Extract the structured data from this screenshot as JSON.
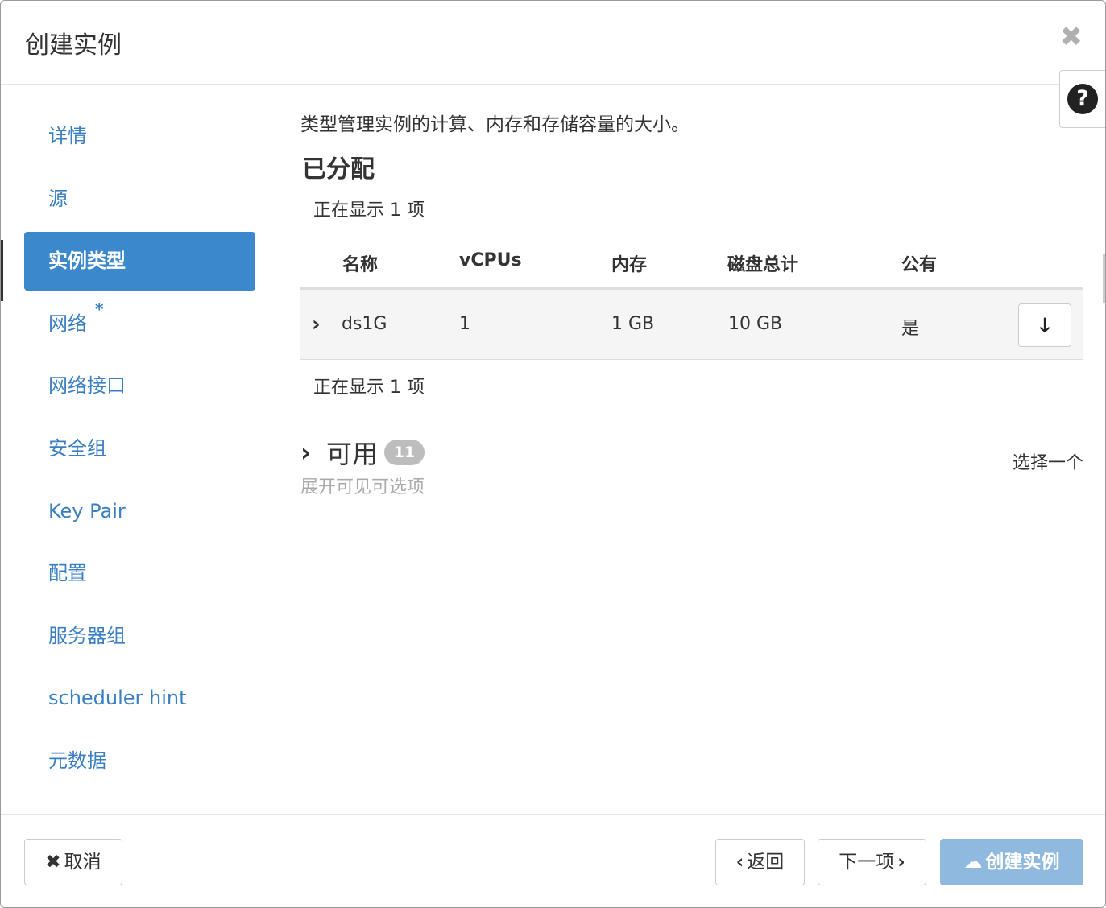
{
  "dialog": {
    "title": "创建实例",
    "close_icon": "×",
    "help_icon": "?"
  },
  "nav": {
    "items": [
      {
        "label": "详情"
      },
      {
        "label": "源"
      },
      {
        "label": "实例类型",
        "active": true
      },
      {
        "label": "网络",
        "required": "*"
      },
      {
        "label": "网络接口"
      },
      {
        "label": "安全组"
      },
      {
        "label": "Key Pair"
      },
      {
        "label": "配置"
      },
      {
        "label": "服务器组"
      },
      {
        "label": "scheduler hint"
      },
      {
        "label": "元数据"
      }
    ]
  },
  "content": {
    "description": "类型管理实例的计算、内存和存储容量的大小。",
    "allocated": {
      "title": "已分配",
      "count_top": "正在显示 1 项",
      "count_bottom": "正在显示 1 项",
      "columns": [
        "名称",
        "vCPUs",
        "内存",
        "磁盘总计",
        "公有"
      ],
      "rows": [
        {
          "name": "ds1G",
          "vcpus": "1",
          "ram": "1 GB",
          "disk": "10 GB",
          "public": "是"
        }
      ]
    },
    "available": {
      "title": "可用",
      "badge": "11",
      "hint": "展开可见可选项",
      "select_one": "选择一个"
    }
  },
  "footer": {
    "cancel": "取消",
    "back": "返回",
    "next": "下一项",
    "create": "创建实例"
  },
  "icons": {
    "cancel_icon": "✖",
    "back_icon": "‹",
    "next_icon": "›",
    "expand_icon": "›",
    "download_icon": "🡓",
    "cloud_upload_icon": "☁"
  },
  "colors": {
    "primary": "#3c88cc",
    "link": "#3a7fc3",
    "create_disabled": "#8fb9df"
  }
}
